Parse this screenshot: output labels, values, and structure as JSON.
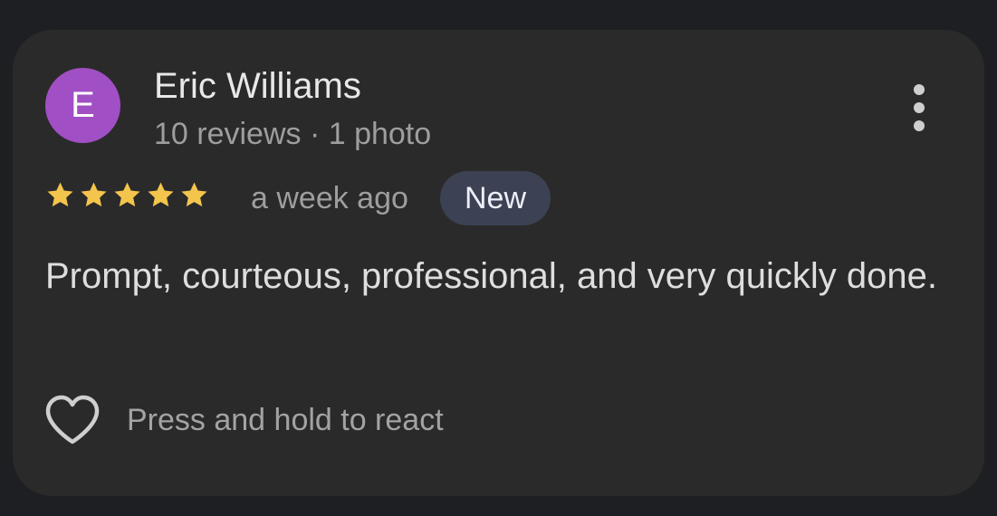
{
  "review": {
    "avatar_letter": "E",
    "author_name": "Eric Williams",
    "author_meta": "10 reviews · 1 photo",
    "rating": 5,
    "max_rating": 5,
    "time_ago": "a week ago",
    "badge": "New",
    "text": "Prompt, courteous, professional, and very quickly done.",
    "react_label": "Press and hold to react"
  },
  "icons": {
    "more": "more-vert-icon",
    "star": "star-icon",
    "react": "heart-outline-icon"
  },
  "colors": {
    "background": "#1e1f22",
    "card": "#2a2a2a",
    "avatar": "#a14fc4",
    "star": "#f4c54c",
    "badge": "#3c4254",
    "icon": "#cfcfcf"
  }
}
